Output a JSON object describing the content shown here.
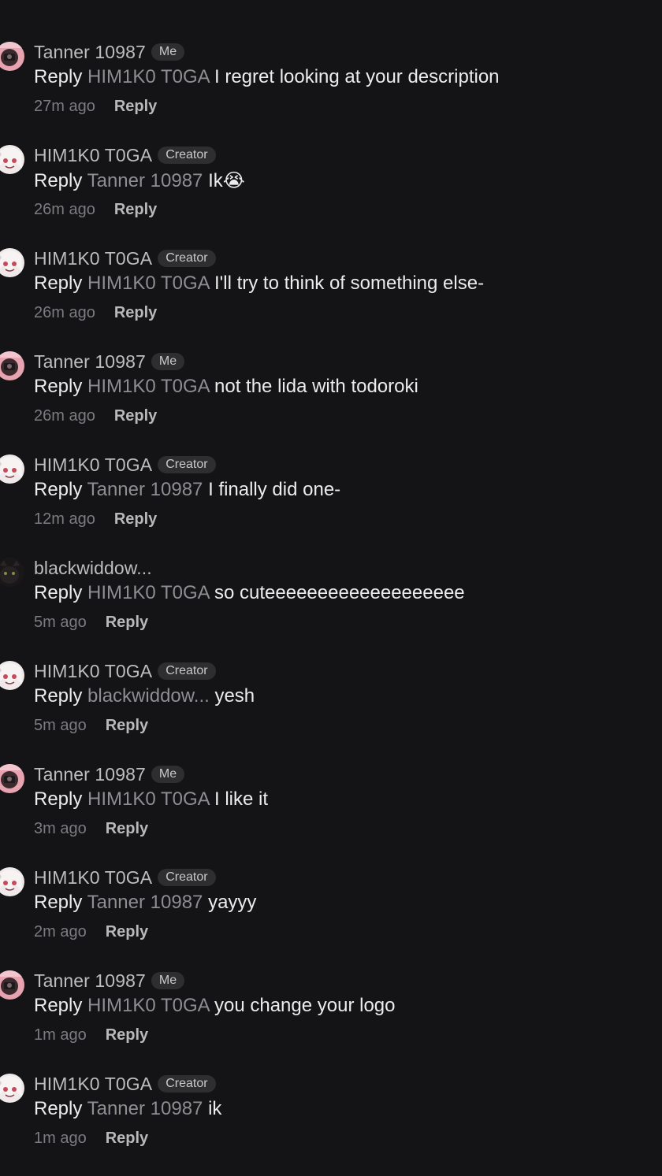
{
  "comments": [
    {
      "user": "Tanner 10987",
      "badge": "Me",
      "prefix": "Reply",
      "mention": "HIM1K0 T0GA",
      "text": "I regret looking at your description",
      "time": "27m ago",
      "reply": "Reply",
      "avatar": "tanner"
    },
    {
      "user": "HIM1K0 T0GA",
      "badge": "Creator",
      "prefix": "Reply",
      "mention": "Tanner 10987",
      "text": "Ik😭",
      "time": "26m ago",
      "reply": "Reply",
      "avatar": "toga"
    },
    {
      "user": "HIM1K0 T0GA",
      "badge": "Creator",
      "prefix": "Reply",
      "mention": "HIM1K0 T0GA",
      "text": "I'll try to think of something else-",
      "time": "26m ago",
      "reply": "Reply",
      "avatar": "toga"
    },
    {
      "user": "Tanner 10987",
      "badge": "Me",
      "prefix": "Reply",
      "mention": "HIM1K0 T0GA",
      "text": "not the lida with todoroki",
      "time": "26m ago",
      "reply": "Reply",
      "avatar": "tanner"
    },
    {
      "user": "HIM1K0 T0GA",
      "badge": "Creator",
      "prefix": "Reply",
      "mention": "Tanner 10987",
      "text": "I finally did one-",
      "time": "12m ago",
      "reply": "Reply",
      "avatar": "toga"
    },
    {
      "user": "blackwiddow...",
      "badge": "",
      "prefix": "Reply",
      "mention": "HIM1K0 T0GA",
      "text": "so cuteeeeeeeeeeeeeeeeeee",
      "time": "5m ago",
      "reply": "Reply",
      "avatar": "black"
    },
    {
      "user": "HIM1K0 T0GA",
      "badge": "Creator",
      "prefix": "Reply",
      "mention": "blackwiddow...",
      "text": "yesh",
      "time": "5m ago",
      "reply": "Reply",
      "avatar": "toga"
    },
    {
      "user": "Tanner 10987",
      "badge": "Me",
      "prefix": "Reply",
      "mention": "HIM1K0 T0GA",
      "text": "I like it",
      "time": "3m ago",
      "reply": "Reply",
      "avatar": "tanner"
    },
    {
      "user": "HIM1K0 T0GA",
      "badge": "Creator",
      "prefix": "Reply",
      "mention": "Tanner 10987",
      "text": "yayyy",
      "time": "2m ago",
      "reply": "Reply",
      "avatar": "toga"
    },
    {
      "user": "Tanner 10987",
      "badge": "Me",
      "prefix": "Reply",
      "mention": "HIM1K0 T0GA",
      "text": "you change your logo",
      "time": "1m ago",
      "reply": "Reply",
      "avatar": "tanner"
    },
    {
      "user": "HIM1K0 T0GA",
      "badge": "Creator",
      "prefix": "Reply",
      "mention": "Tanner 10987",
      "text": "ik",
      "time": "1m ago",
      "reply": "Reply",
      "avatar": "toga"
    }
  ],
  "colors": {
    "background": "#141416",
    "username": "#bdbdbf",
    "mention": "#8e8e92",
    "body_text": "#ececee",
    "badge_bg": "#2e2e31",
    "timestamp": "#7c7c80",
    "reply_button": "#b9b9bc"
  }
}
